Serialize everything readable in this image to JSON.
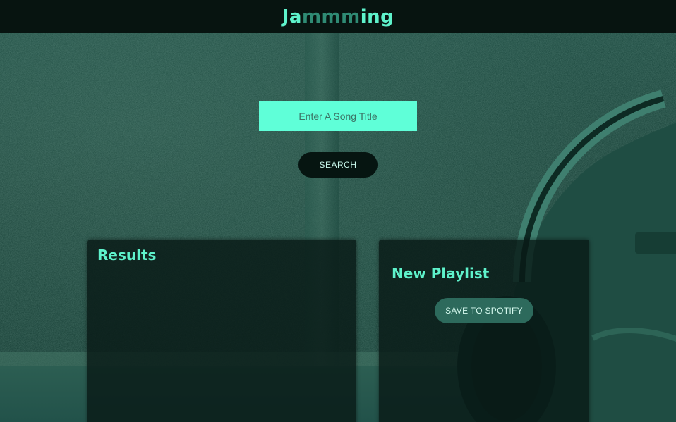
{
  "header": {
    "logo_start": "Ja",
    "logo_mid": "mmm",
    "logo_end": "ing"
  },
  "search": {
    "placeholder": "Enter A Song Title",
    "button_label": "SEARCH"
  },
  "results": {
    "title": "Results"
  },
  "playlist": {
    "title": "New Playlist",
    "save_label": "SAVE TO SPOTIFY"
  },
  "colors": {
    "accent": "#5ef2cb",
    "header_bg": "#071410",
    "input_bg": "#5fffd8",
    "panel_bg": "#081a16"
  }
}
